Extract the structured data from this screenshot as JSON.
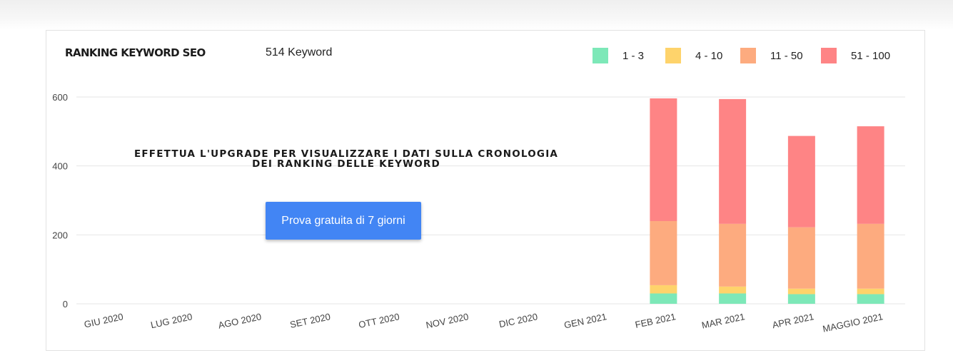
{
  "header": {
    "title": "RANKING KEYWORD SEO",
    "keyword_count": "514 Keyword"
  },
  "upgrade": {
    "line1": "EFFETTUA L'UPGRADE PER VISUALIZZARE I DATI SULLA CRONOLOGIA",
    "line2": "DEI RANKING DELLE KEYWORD",
    "button_label": "Prova gratuita di 7 giorni"
  },
  "colors": {
    "accent_button": "#4285f4",
    "grid": "#e6e6e6"
  },
  "chart_data": {
    "type": "bar",
    "stacked": true,
    "categories": [
      "GIU 2020",
      "LUG 2020",
      "AGO 2020",
      "SET 2020",
      "OTT 2020",
      "NOV 2020",
      "DIC 2020",
      "GEN 2021",
      "FEB 2021",
      "MAR 2021",
      "APR 2021",
      "MAGGIO 2021"
    ],
    "series": [
      {
        "name": "1 - 3",
        "color": "#7de8b8",
        "values": [
          0,
          0,
          0,
          0,
          0,
          0,
          0,
          0,
          30,
          30,
          28,
          28
        ]
      },
      {
        "name": "4 - 10",
        "color": "#fed36b",
        "values": [
          0,
          0,
          0,
          0,
          0,
          0,
          0,
          0,
          24,
          20,
          16,
          16
        ]
      },
      {
        "name": "11 - 50",
        "color": "#fdab7f",
        "values": [
          0,
          0,
          0,
          0,
          0,
          0,
          0,
          0,
          186,
          182,
          178,
          188
        ]
      },
      {
        "name": "51 - 100",
        "color": "#fe8485",
        "values": [
          0,
          0,
          0,
          0,
          0,
          0,
          0,
          0,
          356,
          362,
          265,
          283
        ]
      }
    ],
    "yticks": [
      0,
      200,
      400,
      600
    ],
    "ylim": [
      0,
      600
    ],
    "grid": true,
    "legend_position": "top-right",
    "title": "RANKING KEYWORD SEO",
    "xlabel": "",
    "ylabel": ""
  }
}
